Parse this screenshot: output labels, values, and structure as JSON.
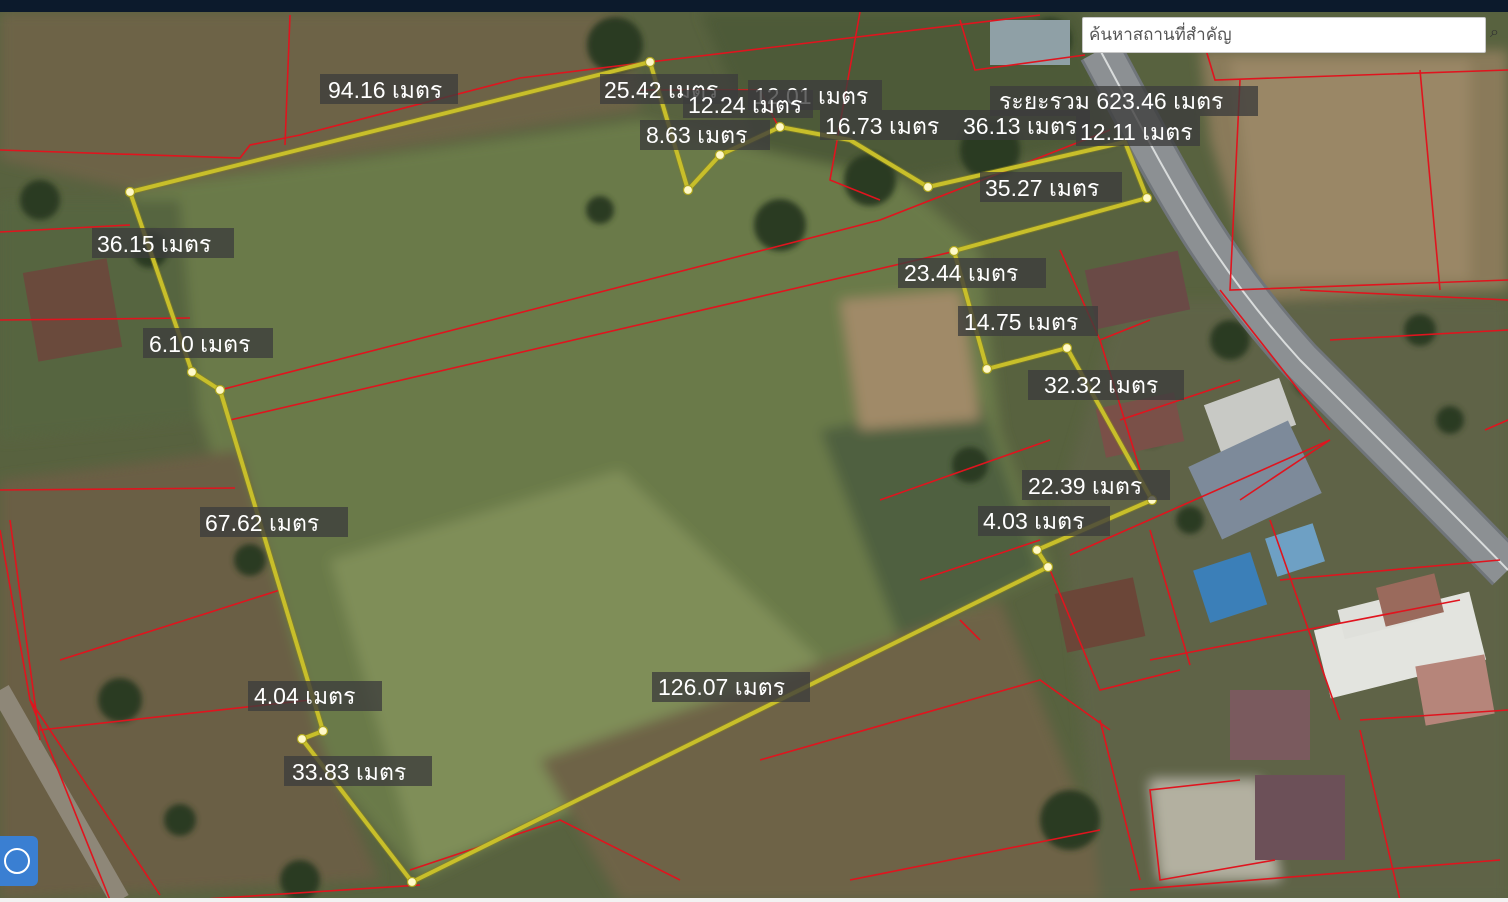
{
  "search": {
    "placeholder": "ค้นหาสถานที่สำคัญ"
  },
  "total": {
    "text": "ระยะรวม 623.46 เมตร"
  },
  "measurements": [
    "94.16 เมตร",
    "25.42 เมตร",
    "12.01 เมตร",
    "12.24 เมตร",
    "8.63 เมตร",
    "16.73 เมตร",
    "36.13 เมตร",
    "12.11 เมตร",
    "35.27 เมตร",
    "23.44 เมตร",
    "14.75 เมตร",
    "32.32 เมตร",
    "22.39 เมตร",
    "4.03 เมตร",
    "126.07 เมตร",
    "33.83 เมตร",
    "4.04 เมตร",
    "67.62 เมตร",
    "6.10 เมตร",
    "36.15 เมตร"
  ],
  "colors": {
    "measure_line": "#c8bf2a",
    "parcel_boundary": "#e0141e",
    "label_bg": "#3c3c3c",
    "label_text": "#ffffff",
    "locate_button": "#3a7fd2"
  },
  "icons": {
    "search": "search-icon",
    "locate": "locate-icon"
  }
}
